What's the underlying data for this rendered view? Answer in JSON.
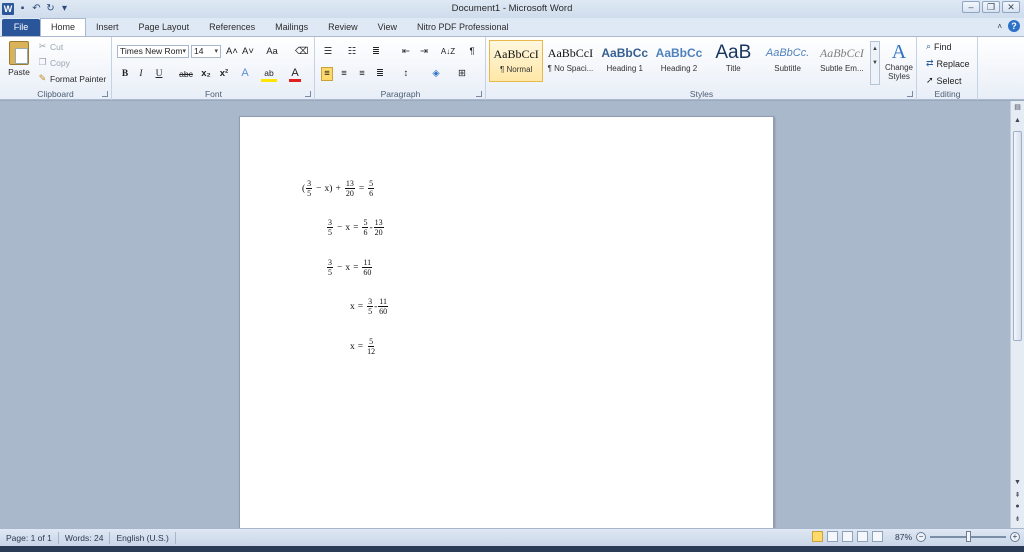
{
  "titlebar": {
    "title": "Document1 - Microsoft Word"
  },
  "tabs": [
    "File",
    "Home",
    "Insert",
    "Page Layout",
    "References",
    "Mailings",
    "Review",
    "View",
    "Nitro PDF Professional"
  ],
  "clipboard": {
    "paste": "Paste",
    "cut": "Cut",
    "copy": "Copy",
    "format_painter": "Format Painter",
    "label": "Clipboard"
  },
  "font": {
    "family": "Times New Rom",
    "size": "14",
    "label": "Font",
    "bold": "B",
    "italic": "I",
    "underline": "U",
    "strike": "abc",
    "subscript": "x₂",
    "superscript": "x²",
    "grow": "A˄",
    "shrink": "A˅",
    "change_case": "Aa",
    "font_color": "A",
    "highlight": "ab",
    "text_effects": "A"
  },
  "paragraph": {
    "label": "Paragraph",
    "pilcrow": "¶",
    "sort": "A↓Z"
  },
  "styles": {
    "label": "Styles",
    "items": [
      {
        "sample": "AaBbCcI",
        "name": "¶ Normal"
      },
      {
        "sample": "AaBbCcI",
        "name": "¶ No Spaci..."
      },
      {
        "sample": "AaBbCc",
        "name": "Heading 1"
      },
      {
        "sample": "AaBbCc",
        "name": "Heading 2"
      },
      {
        "sample": "AaB",
        "name": "Title"
      },
      {
        "sample": "AaBbCc.",
        "name": "Subtitle"
      },
      {
        "sample": "AaBbCcI",
        "name": "Subtle Em..."
      }
    ],
    "change_styles": "Change Styles"
  },
  "editing": {
    "label": "Editing",
    "find": "Find",
    "replace": "Replace",
    "select": "Select"
  },
  "document": {
    "line1": {
      "f1n": "3",
      "f1d": "5",
      "minus": "−",
      "x": "x)",
      "plus": "+",
      "f2n": "13",
      "f2d": "20",
      "eq": "=",
      "f3n": "5",
      "f3d": "6",
      "open": "("
    },
    "line2": {
      "f1n": "3",
      "f1d": "5",
      "minus": "−",
      "x": "x",
      "eq": "=",
      "f2n": "5",
      "f2d": "6",
      "dash": "-",
      "f3n": "13",
      "f3d": "20"
    },
    "line3": {
      "f1n": "3",
      "f1d": "5",
      "minus": "−",
      "x": "x",
      "eq": "=",
      "f2n": "11",
      "f2d": "60"
    },
    "line4": {
      "x": "x",
      "eq": "=",
      "f1n": "3",
      "f1d": "5",
      "dash": "-",
      "f2n": "11",
      "f2d": "60"
    },
    "line5": {
      "x": "x",
      "eq": "=",
      "f1n": "5",
      "f1d": "12"
    }
  },
  "status": {
    "page": "Page: 1 of 1",
    "words": "Words: 24",
    "language": "English (U.S.)",
    "zoom": "87%"
  }
}
